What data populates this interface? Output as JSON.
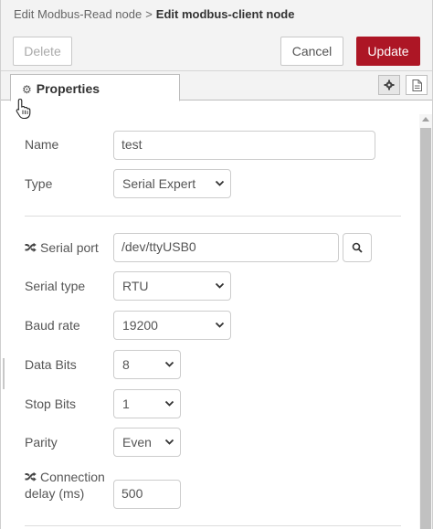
{
  "breadcrumb": {
    "parent": "Edit Modbus-Read node",
    "separator": ">",
    "current": "Edit modbus-client node"
  },
  "toolbar": {
    "delete_label": "Delete",
    "cancel_label": "Cancel",
    "update_label": "Update"
  },
  "tabs": {
    "properties_label": "Properties"
  },
  "icons": {
    "properties_tab": "gear-icon",
    "settings_tab": "gear-icon",
    "description_tab": "document-icon",
    "serial_port": "shuffle-icon",
    "connection_delay": "shuffle-icon",
    "port_search": "search-icon",
    "cursor": "hand-pointer-icon"
  },
  "colors": {
    "update_button": "#ad1625",
    "header_bg": "#f3f3f3"
  },
  "form": {
    "name": {
      "label": "Name",
      "value": "test"
    },
    "type": {
      "label": "Type",
      "value": "Serial Expert"
    },
    "serial_port": {
      "label": "Serial port",
      "value": "/dev/ttyUSB0"
    },
    "serial_type": {
      "label": "Serial type",
      "value": "RTU"
    },
    "baud_rate": {
      "label": "Baud rate",
      "value": "19200"
    },
    "data_bits": {
      "label": "Data Bits",
      "value": "8"
    },
    "stop_bits": {
      "label": "Stop Bits",
      "value": "1"
    },
    "parity": {
      "label": "Parity",
      "value": "Even"
    },
    "connection_delay": {
      "label_line1": "Connection",
      "label_line2": "delay (ms)",
      "value": "500"
    }
  }
}
